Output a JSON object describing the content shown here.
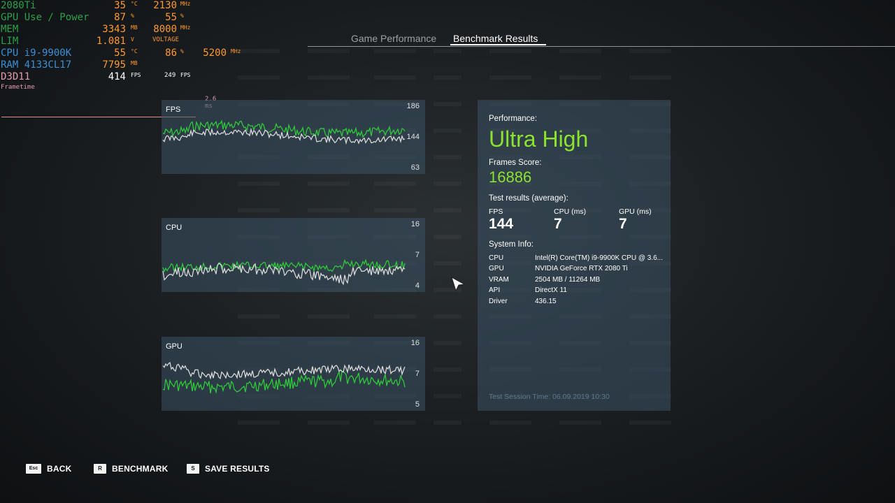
{
  "osd": {
    "gpu_name": "2080Ti",
    "gpu_temp": "35",
    "gpu_temp_unit": "°C",
    "gpu_clock": "2130",
    "gpu_clock_unit": "MHz",
    "gpu_use_label": "GPU Use / Power",
    "gpu_use": "87",
    "gpu_use_unit": "%",
    "gpu_power": "55",
    "gpu_power_unit": "%",
    "mem_label": "MEM",
    "mem_used": "3343",
    "mem_used_unit": "MB",
    "mem_clock": "8000",
    "mem_clock_unit": "MHz",
    "lim_label": "LIM",
    "voltage": "1.081",
    "voltage_unit": "V",
    "voltage_label": "VOLTAGE",
    "cpu_name": "CPU i9-9900K",
    "cpu_temp": "55",
    "cpu_temp_unit": "°C",
    "cpu_use": "86",
    "cpu_use_unit": "%",
    "cpu_clock": "5200",
    "cpu_clock_unit": "MHz",
    "ram_name": "RAM 4133CL17",
    "ram_used": "7795",
    "ram_used_unit": "MB",
    "api_name": "D3D11",
    "fps": "414",
    "fps_unit": "FPS",
    "fps2": "249",
    "fps2_unit": "FPS",
    "frametime_label": "Frametime",
    "frametime_ms": "2.6 ms"
  },
  "tabs": [
    {
      "label": "Game Performance",
      "active": false
    },
    {
      "label": "Benchmark Results",
      "active": true
    }
  ],
  "graphs": [
    {
      "title": "FPS",
      "top_label": "186",
      "mid_label": "144",
      "low_label": "63",
      "colors": {
        "primary": "#2fc93a",
        "secondary": "#d8d8d8"
      }
    },
    {
      "title": "CPU",
      "top_label": "16",
      "mid_label": "7",
      "low_label": "4",
      "colors": {
        "primary": "#2fc93a",
        "secondary": "#d8d8d8"
      }
    },
    {
      "title": "GPU",
      "top_label": "16",
      "mid_label": "7",
      "low_label": "5",
      "colors": {
        "primary": "#2fc93a",
        "secondary": "#d8d8d8"
      }
    }
  ],
  "results": {
    "performance_label": "Performance:",
    "performance_value": "Ultra High",
    "score_label": "Frames Score:",
    "score_value": "16886",
    "test_results_label": "Test results (average):",
    "columns": [
      {
        "head": "FPS",
        "value": "144"
      },
      {
        "head": "CPU (ms)",
        "value": "7"
      },
      {
        "head": "GPU (ms)",
        "value": "7"
      }
    ],
    "system_info_label": "System Info:",
    "system_info": [
      {
        "key": "CPU",
        "value": "Intel(R) Core(TM) i9-9900K CPU @ 3.6..."
      },
      {
        "key": "GPU",
        "value": "NVIDIA GeForce RTX 2080 Ti"
      },
      {
        "key": "VRAM",
        "value": "2504 MB / 11264 MB"
      },
      {
        "key": "API",
        "value": "DirectX 11"
      },
      {
        "key": "Driver",
        "value": "436.15"
      }
    ],
    "session_time": "Test Session Time: 06.09.2019 10:30",
    "accent_color": "#8be32e"
  },
  "actions": [
    {
      "key": "Esc",
      "label": "BACK"
    },
    {
      "key": "R",
      "label": "BENCHMARK"
    },
    {
      "key": "S",
      "label": "SAVE RESULTS"
    }
  ]
}
